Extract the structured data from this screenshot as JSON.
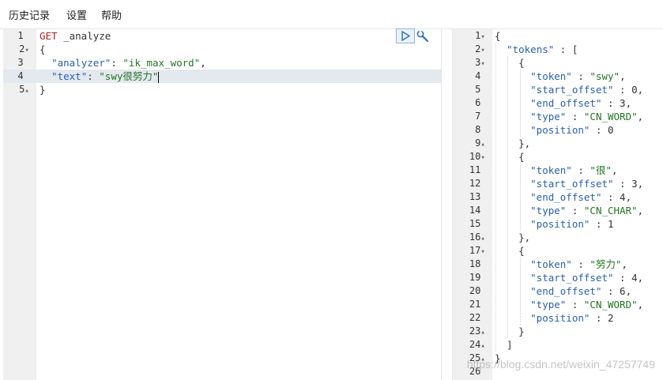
{
  "menu": {
    "history": "历史记录",
    "settings": "设置",
    "help": "帮助"
  },
  "request_editor": {
    "line_numbers": [
      "1",
      "2",
      "3",
      "4",
      "5"
    ],
    "method": "GET",
    "path": "_analyze",
    "analyzer_key": "\"analyzer\"",
    "analyzer_value": "\"ik_max_word\"",
    "text_key": "\"text\"",
    "text_value": "\"swy很努力\""
  },
  "response_editor": {
    "line_numbers": [
      "1",
      "2",
      "3",
      "4",
      "5",
      "6",
      "7",
      "8",
      "9",
      "10",
      "11",
      "12",
      "13",
      "14",
      "15",
      "16",
      "17",
      "18",
      "19",
      "20",
      "21",
      "22",
      "23",
      "24",
      "25",
      "26"
    ],
    "tokens_key": "\"tokens\"",
    "tokens": [
      {
        "token": "\"swy\"",
        "start_offset": "0",
        "end_offset": "3",
        "type": "\"CN_WORD\"",
        "position": "0"
      },
      {
        "token": "\"很\"",
        "start_offset": "3",
        "end_offset": "4",
        "type": "\"CN_CHAR\"",
        "position": "1"
      },
      {
        "token": "\"努力\"",
        "start_offset": "4",
        "end_offset": "6",
        "type": "\"CN_WORD\"",
        "position": "2"
      }
    ],
    "keys": {
      "token": "\"token\"",
      "start_offset": "\"start_offset\"",
      "end_offset": "\"end_offset\"",
      "type": "\"type\"",
      "position": "\"position\""
    }
  },
  "watermark": "https://blog.csdn.net/weixin_47257749",
  "icons": {
    "run": "play-icon",
    "settings": "wrench-icon"
  }
}
